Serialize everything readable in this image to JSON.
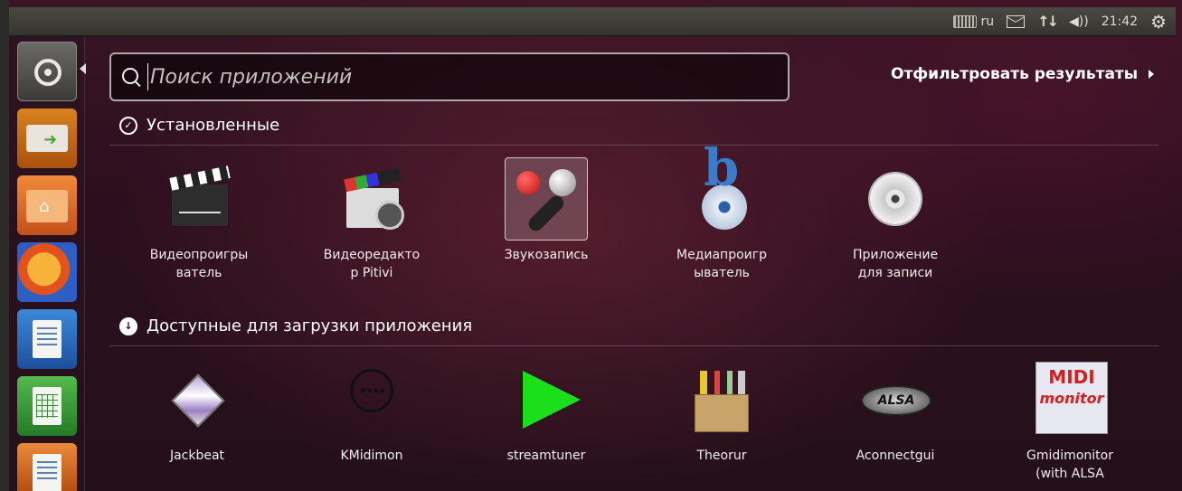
{
  "top_panel": {
    "language": "ru",
    "time": "21:42",
    "icons": [
      "keyboard-icon",
      "mail-icon",
      "network-icon",
      "volume-icon",
      "session-gear-icon"
    ]
  },
  "launcher": {
    "items": [
      {
        "name": "dash-home",
        "icon": "ubuntu-logo-icon"
      },
      {
        "name": "software-installer",
        "icon": "drive-install-icon"
      },
      {
        "name": "home-folder",
        "icon": "folder-home-icon"
      },
      {
        "name": "firefox",
        "icon": "firefox-icon"
      },
      {
        "name": "libreoffice-writer",
        "icon": "writer-icon"
      },
      {
        "name": "libreoffice-calc",
        "icon": "calc-icon"
      },
      {
        "name": "libreoffice-impress",
        "icon": "impress-icon"
      }
    ]
  },
  "search": {
    "placeholder": "Поиск приложений",
    "value": ""
  },
  "filter": {
    "label": "Отфильтровать результаты"
  },
  "sections": {
    "installed": {
      "title": "Установленные",
      "apps": [
        {
          "label": "Видеопроигрыватель",
          "label_lines": [
            "Видеопроигры",
            "ватель"
          ],
          "icon": "video-clapper-icon"
        },
        {
          "label": "Видеоредактор Pitivi",
          "label_lines": [
            "Видеоредакто",
            "р Pitivi"
          ],
          "icon": "pitivi-icon"
        },
        {
          "label": "Звукозапись",
          "label_lines": [
            "Звукозапись",
            ""
          ],
          "icon": "microphone-icon"
        },
        {
          "label": "Медиапроигрыватель",
          "label_lines": [
            "Медиапроигр",
            "ыватель"
          ],
          "icon": "banshee-icon"
        },
        {
          "label": "Приложение для записи",
          "label_lines": [
            "Приложение",
            "для записи"
          ],
          "icon": "disc-burner-icon"
        }
      ]
    },
    "available": {
      "title": "Доступные для загрузки приложения",
      "apps": [
        {
          "label": "Jackbeat",
          "label_lines": [
            "Jackbeat",
            ""
          ],
          "icon": "jackbeat-icon"
        },
        {
          "label": "KMidimon",
          "label_lines": [
            "KMidimon",
            ""
          ],
          "icon": "midi-connector-icon"
        },
        {
          "label": "streamtuner",
          "label_lines": [
            "streamtuner",
            ""
          ],
          "icon": "play-icon"
        },
        {
          "label": "Theorur",
          "label_lines": [
            "Theorur",
            ""
          ],
          "icon": "toolbox-icon"
        },
        {
          "label": "Aconnectgui",
          "label_lines": [
            "Aconnectgui",
            ""
          ],
          "icon": "alsa-icon"
        },
        {
          "label": "Gmidimonitor (with ALSA",
          "label_lines": [
            "Gmidimonitor",
            "(with ALSA"
          ],
          "icon": "gmidimonitor-icon"
        }
      ],
      "gmidimonitor_logo_text": [
        "MIDI",
        "monitor"
      ]
    }
  },
  "alsa_logo_text": "ALSA"
}
